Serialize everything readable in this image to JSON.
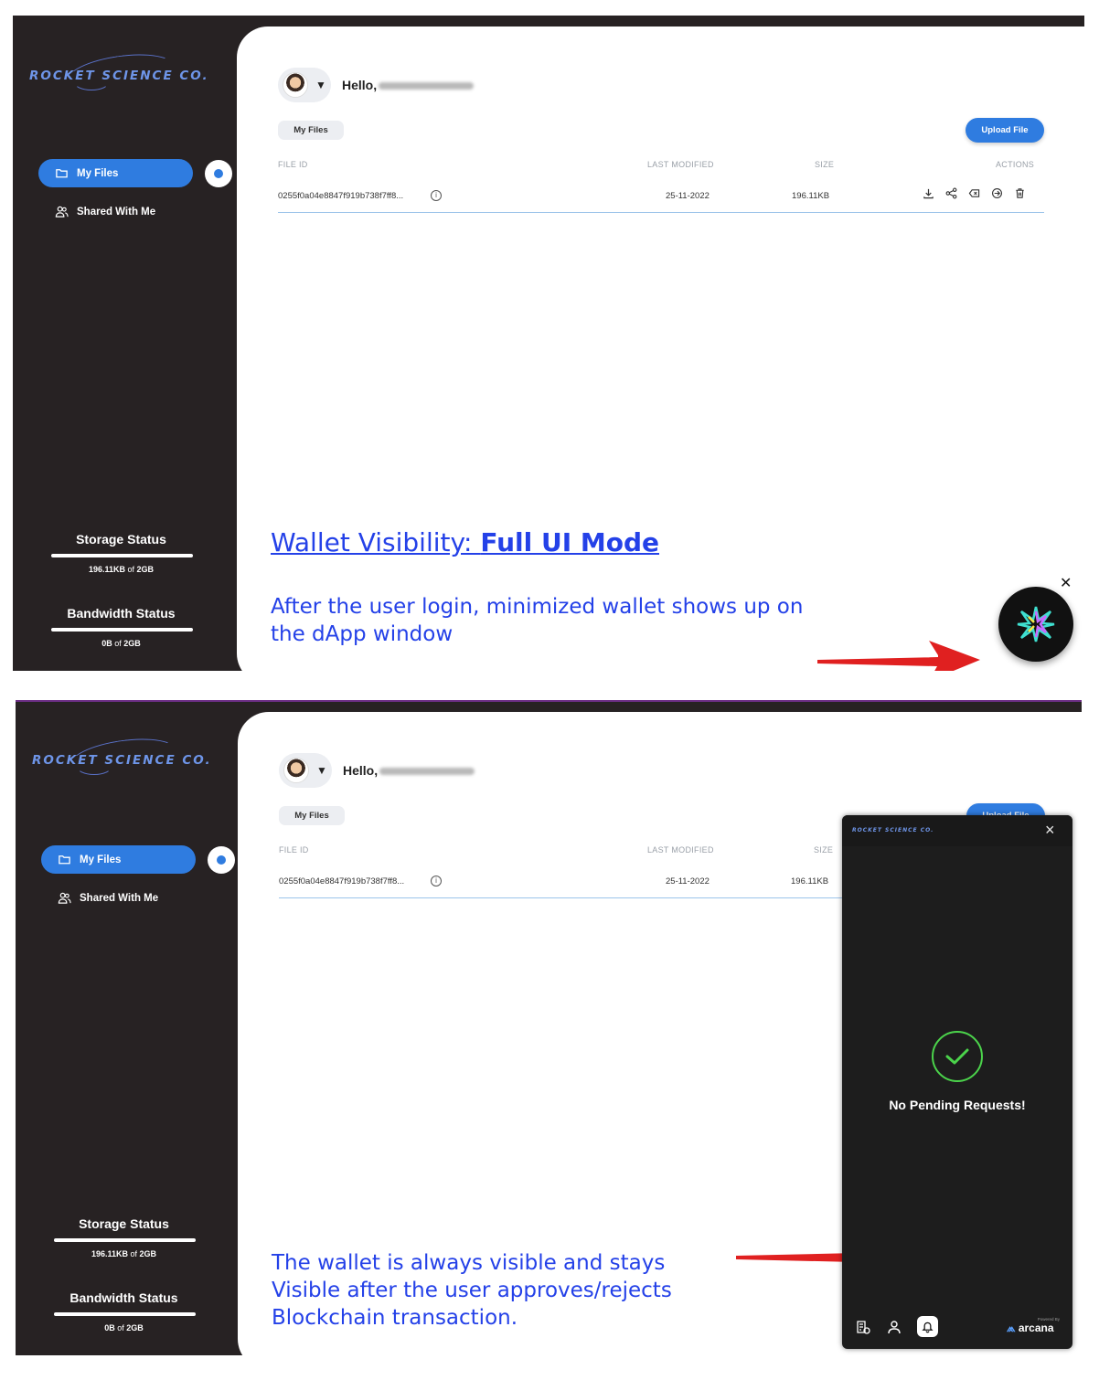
{
  "brand": "ROCKET SCIENCE CO.",
  "sidebar": {
    "items": [
      {
        "label": "My Files",
        "icon": "folder-icon"
      },
      {
        "label": "Shared With Me",
        "icon": "users-icon"
      }
    ],
    "storage": {
      "title": "Storage Status",
      "used": "196.11KB",
      "of": "of",
      "total": "2GB",
      "fill": 1.0
    },
    "bandwidth": {
      "title": "Bandwidth Status",
      "used": "0B",
      "of": "of",
      "total": "2GB",
      "fill": 1.0
    }
  },
  "header": {
    "greeting": "Hello,"
  },
  "tab": {
    "label": "My Files"
  },
  "upload_label": "Upload File",
  "upload_label_partial": "Upload File",
  "table": {
    "columns": [
      "FILE ID",
      "LAST MODIFIED",
      "SIZE",
      "ACTIONS"
    ],
    "rows": [
      {
        "file_id": "0255f0a04e8847f919b738f7ff8...",
        "last_modified": "25-11-2022",
        "size": "196.11KB"
      }
    ],
    "action_icons": [
      "download-icon",
      "share-icon",
      "revoke-icon",
      "transfer-icon",
      "delete-icon"
    ]
  },
  "caption1": {
    "title_prefix": "Wallet Visibility: ",
    "title_bold": "Full UI Mode",
    "line1": "After the user login, minimized wallet shows up on",
    "line2": "the dApp window"
  },
  "caption2": {
    "line1": "The wallet is always visible and stays",
    "line2": "Visible after the user approves/rejects",
    "line3": "Blockchain transaction."
  },
  "wallet": {
    "brand": "ROCKET SCIENCE CO.",
    "close": "×",
    "message": "No Pending Requests!",
    "powered_by": "Powered By",
    "provider": "arcana",
    "footer_icons": [
      "assets-icon",
      "profile-icon",
      "bell-icon"
    ]
  },
  "colors": {
    "accent": "#2f7ce0",
    "sidebar": "#272223",
    "caption": "#2441e8",
    "arrow": "#e02020",
    "success": "#4bd34b"
  }
}
